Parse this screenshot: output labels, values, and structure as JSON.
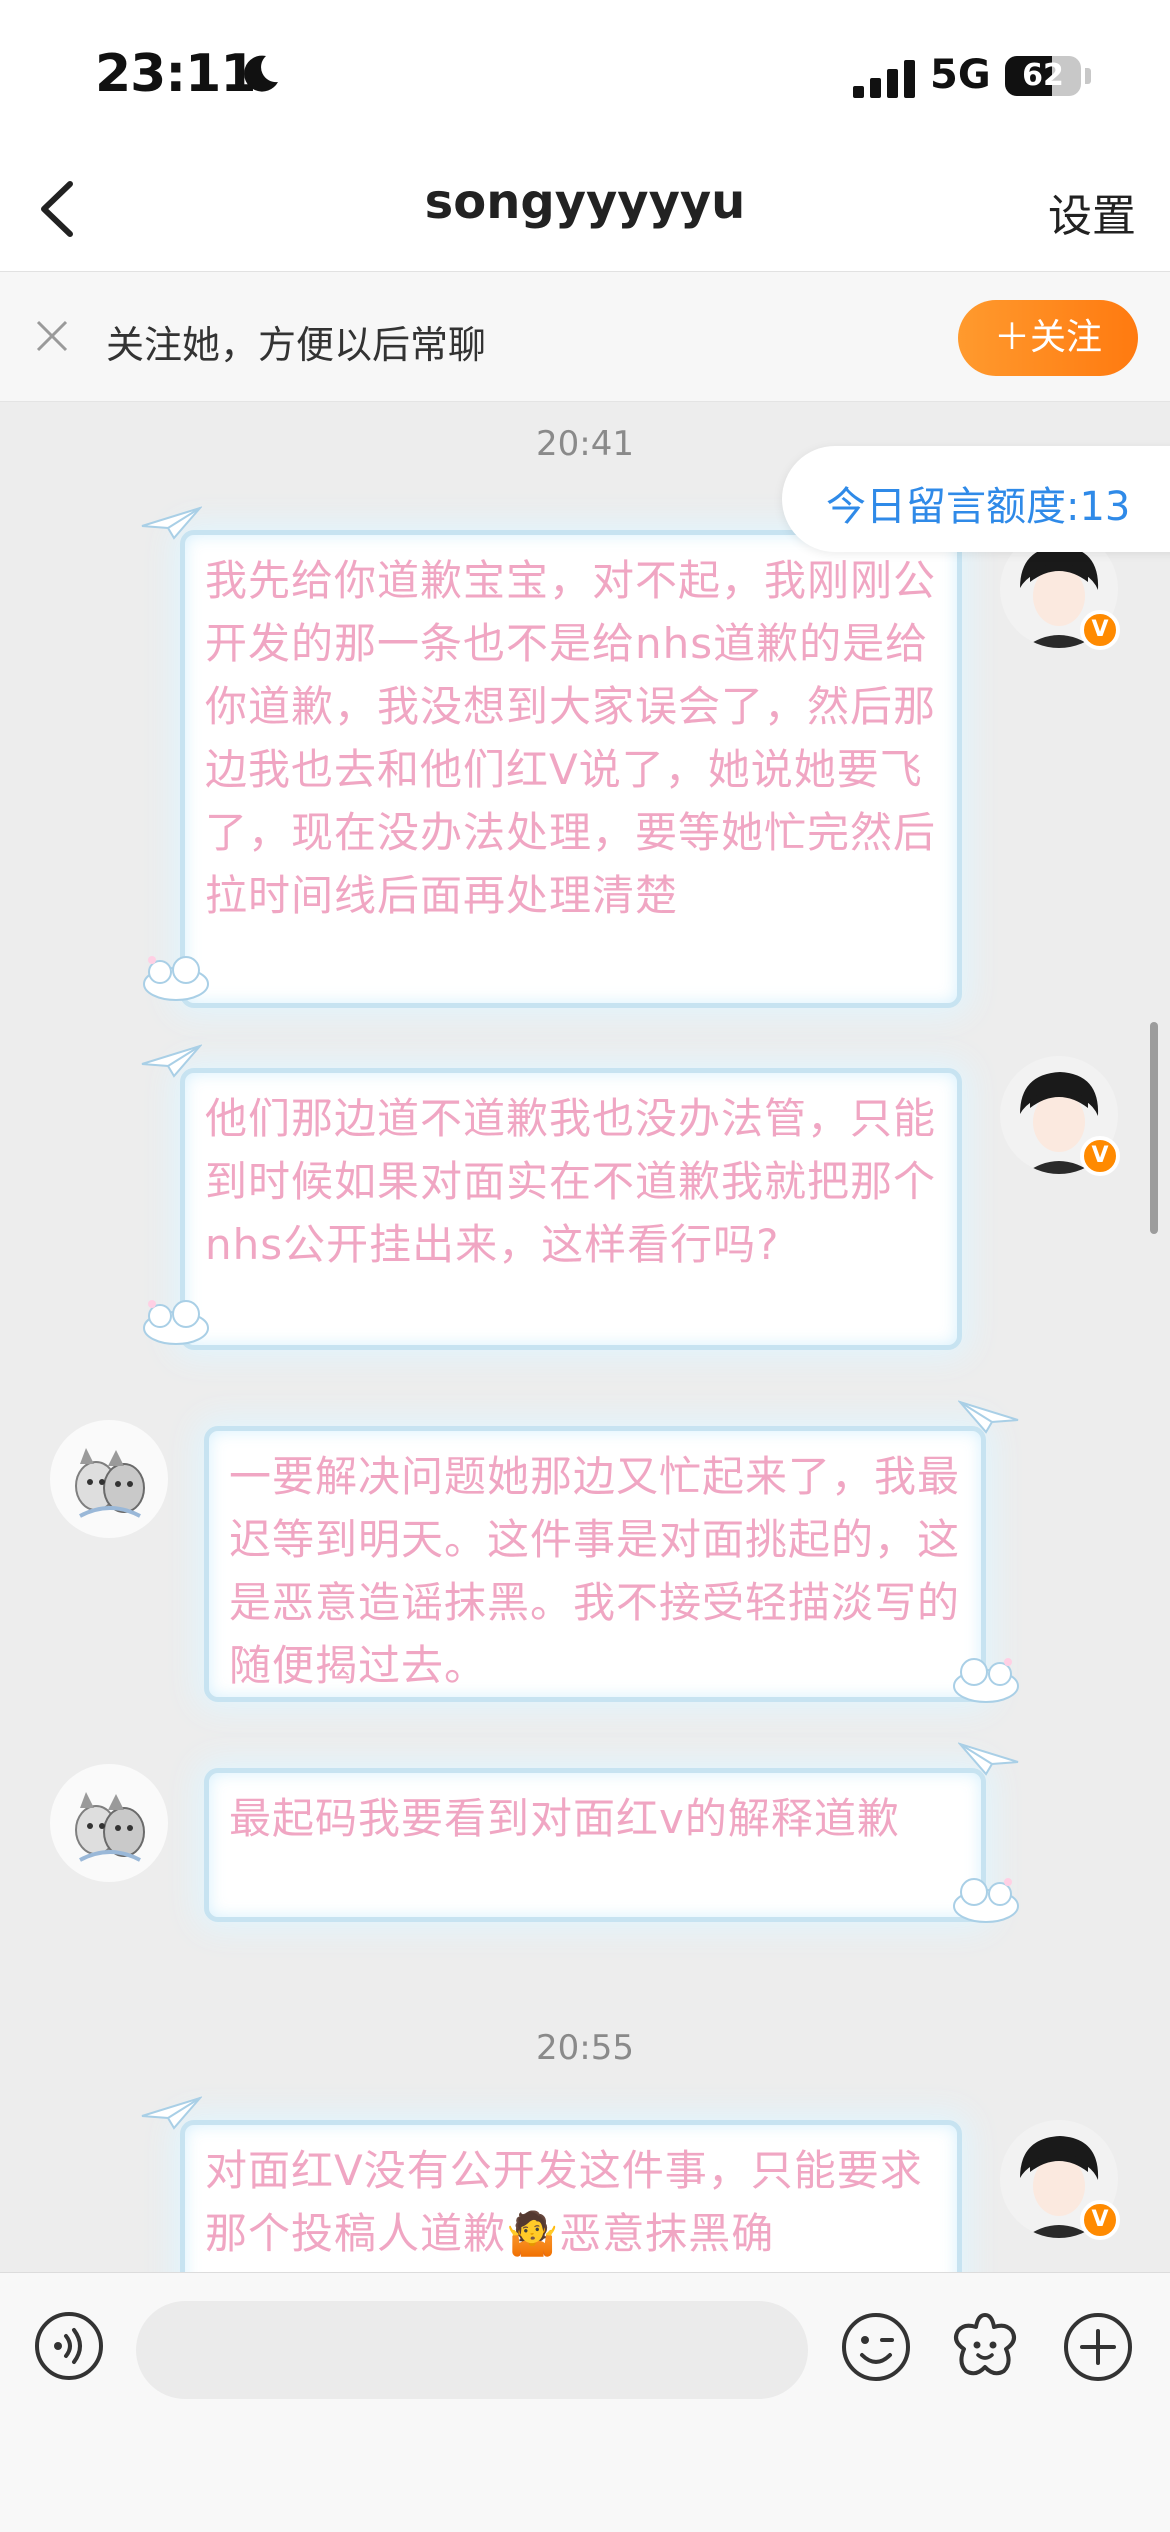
{
  "status_bar": {
    "time": "23:11",
    "network": "5G",
    "battery": "62",
    "battery_level": 0.62,
    "icons": [
      "moon-icon",
      "signal-icon",
      "battery-icon"
    ]
  },
  "nav": {
    "title": "songyyyyyu",
    "settings_label": "设置",
    "back_icon": "chevron-left-icon"
  },
  "follow_banner": {
    "text": "关注她，方便以后常聊",
    "button_label": "＋关注",
    "close_icon": "close-icon"
  },
  "chat": {
    "quota_label": "今日留言额度:13",
    "timestamps": [
      "20:41",
      "20:55"
    ],
    "messages": [
      {
        "side": "right",
        "text": "我先给你道歉宝宝，对不起，我刚刚公开发的那一条也不是给nhs道歉的是给你道歉，我没想到大家误会了，然后那边我也去和他们红V说了，她说她要飞了，现在没办法处理，要等她忙完然后拉时间线后面再处理清楚"
      },
      {
        "side": "right",
        "text": "他们那边道不道歉我也没办法管，只能到时候如果对面实在不道歉我就把那个nhs公开挂出来，这样看行吗?"
      },
      {
        "side": "left",
        "text": "一要解决问题她那边又忙起来了，我最迟等到明天。这件事是对面挑起的，这是恶意造谣抹黑。我不接受轻描淡写的随便揭过去。"
      },
      {
        "side": "left",
        "text": "最起码我要看到对面红v的解释道歉"
      },
      {
        "side": "right",
        "text": "对面红V没有公开发这件事，只能要求那个投稿人道歉🤷恶意抹黑确"
      }
    ]
  },
  "input_bar": {
    "placeholder": "",
    "icons": [
      "voice-icon",
      "emoji-icon",
      "sticker-icon",
      "plus-icon"
    ]
  },
  "colors": {
    "accent_orange": "#ff8a1a",
    "bubble_text": "#f0a6c3",
    "quota_blue": "#2f8ae8",
    "bubble_border": "#c7e3f1"
  }
}
